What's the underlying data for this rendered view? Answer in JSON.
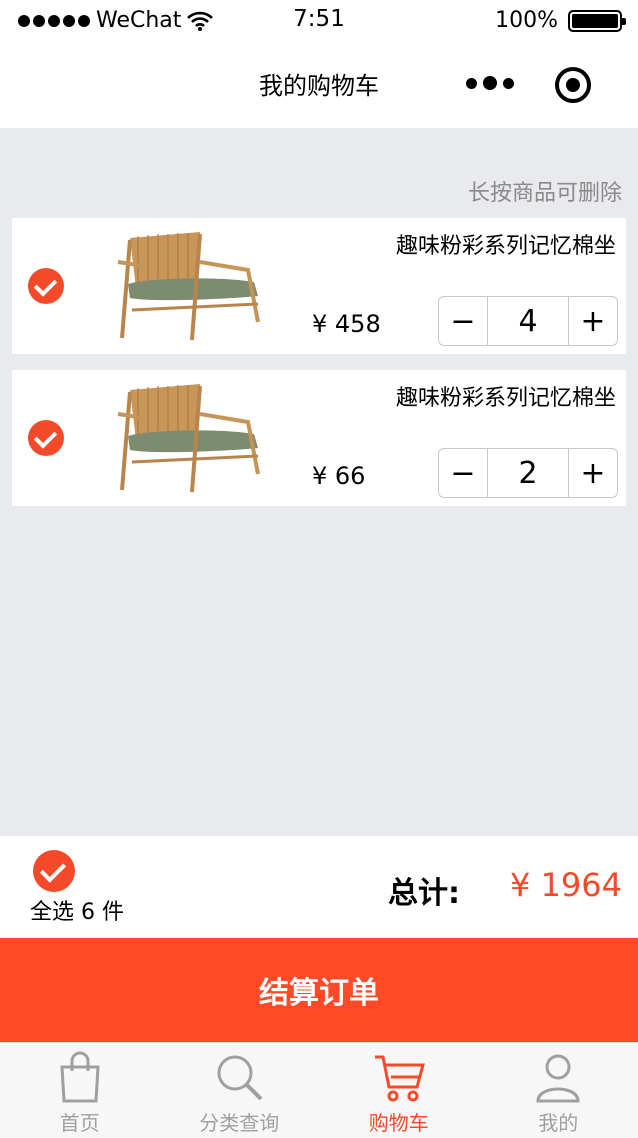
{
  "status_bar": {
    "carrier": "WeChat",
    "time": "7:51",
    "battery": "100%"
  },
  "nav": {
    "title": "我的购物车"
  },
  "hint": "长按商品可删除",
  "cart_items": [
    {
      "name": "趣味粉彩系列记忆棉坐",
      "price": "¥ 458",
      "qty": "4",
      "minus": "−",
      "plus": "+"
    },
    {
      "name": "趣味粉彩系列记忆棉坐",
      "price": "¥ 66",
      "qty": "2",
      "minus": "−",
      "plus": "+"
    }
  ],
  "footer": {
    "select_all": "全选 6 件",
    "total_label": "总计:",
    "total_value": "¥ 1964"
  },
  "checkout": {
    "label": "结算订单"
  },
  "tabs": [
    {
      "label": "首页",
      "icon": "shopping-bag-icon"
    },
    {
      "label": "分类查询",
      "icon": "search-icon"
    },
    {
      "label": "购物车",
      "icon": "cart-icon"
    },
    {
      "label": "我的",
      "icon": "user-icon"
    }
  ],
  "colors": {
    "accent": "#f54a2a",
    "checkout_bg": "#fe4a26",
    "page_bg": "#e9eaee",
    "inactive_tab": "#a0a0a0"
  }
}
